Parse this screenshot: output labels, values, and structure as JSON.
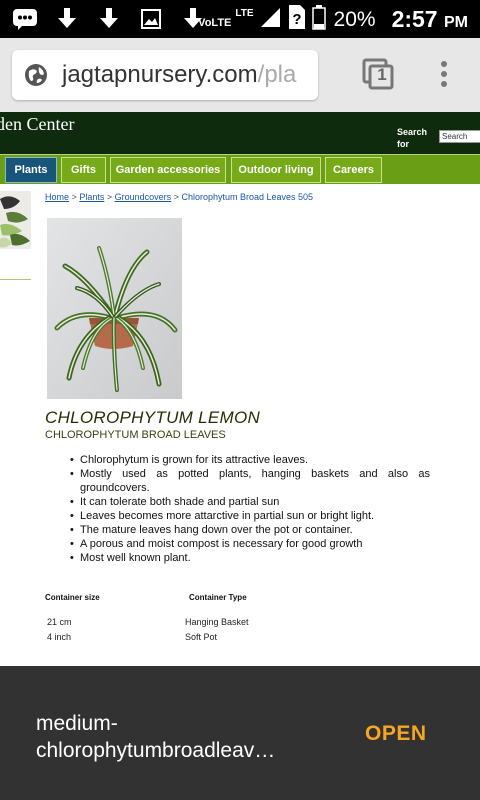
{
  "status_bar": {
    "volte": "VoLTE",
    "lte": "LTE",
    "battery": "20%",
    "time": "2:57",
    "ampm": "PM",
    "icons": [
      "chat-icon",
      "download-icon",
      "download-icon",
      "image-icon",
      "download-icon",
      "signal-icon",
      "unknown-sim-icon",
      "battery-icon"
    ]
  },
  "browser": {
    "url_domain": "jagtapnursery.com",
    "url_path": "/pla",
    "tab_count": "1"
  },
  "site": {
    "brand": "den Center",
    "search_label_1": "Search",
    "search_label_2": "for",
    "search_placeholder": "Search"
  },
  "nav": {
    "items": [
      {
        "label": "Plants"
      },
      {
        "label": "Gifts"
      },
      {
        "label": "Garden accessories"
      },
      {
        "label": "Outdoor living"
      },
      {
        "label": "Careers"
      }
    ]
  },
  "breadcrumb": {
    "home": "Home",
    "plants": "Plants",
    "groundcovers": "Groundcovers",
    "current": "Chlorophytum Broad Leaves 505",
    "sep": ">"
  },
  "product": {
    "title": "CHLOROPHYTUM LEMON",
    "subtitle": "CHLOROPHYTUM BROAD LEAVES",
    "features": [
      "Chlorophytum is grown for its attractive leaves.",
      "Mostly used as potted plants, hanging baskets and also as groundcovers.",
      "It can tolerate both shade and partial sun",
      "Leaves becomes more attarctive in partial sun or bright light.",
      "The mature leaves hang down over the pot or container.",
      "A porous and moist compost is necessary for good growth",
      "Most well known plant."
    ],
    "table": {
      "headers": [
        "Container size",
        "Container Type"
      ],
      "rows": [
        [
          "21 cm",
          "Hanging Basket"
        ],
        [
          "4 inch",
          "Soft Pot"
        ]
      ]
    }
  },
  "snackbar": {
    "filename": "medium-chlorophytumbroadleav…",
    "action": "OPEN"
  },
  "colors": {
    "header_bg": "#0e2b0e",
    "nav_bg": "#77aa19",
    "nav_active": "#17557a",
    "link": "#1a57a8",
    "snackbar_bg": "#323232",
    "snackbar_action": "#f5a623"
  }
}
